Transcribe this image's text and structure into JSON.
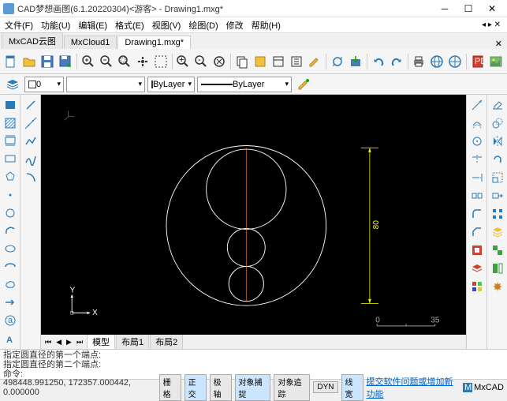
{
  "title": "CAD梦想画图(6.1.20220304)<游客> - Drawing1.mxg*",
  "menu": [
    "文件(F)",
    "功能(U)",
    "编辑(E)",
    "格式(E)",
    "视图(V)",
    "绘图(D)",
    "修改",
    "帮助(H)"
  ],
  "tabs": [
    "MxCAD云图",
    "MxCloud1",
    "Drawing1.mxg*"
  ],
  "activeTab": 2,
  "layerDrop1": "0",
  "layerDrop2": "ByLayer",
  "layerDrop3": "ByLayer",
  "bottomTabs": [
    "模型",
    "布局1",
    "布局2"
  ],
  "activeBottomTab": 0,
  "cmd": {
    "line1": "指定圆直径的第一个端点:",
    "line2": "指定圆直径的第二个端点:",
    "prompt": "命令:"
  },
  "coords": "498448.991250,  172357.000442,  0.000000",
  "status": [
    "栅格",
    "正交",
    "极轴",
    "对象捕捉",
    "对象追踪",
    "DYN",
    "线宽"
  ],
  "statusLink": "提交软件问题或增加新功能",
  "brand": "MxCAD",
  "drawing": {
    "dim": "80",
    "scale": {
      "start": "0",
      "end": "35"
    }
  }
}
